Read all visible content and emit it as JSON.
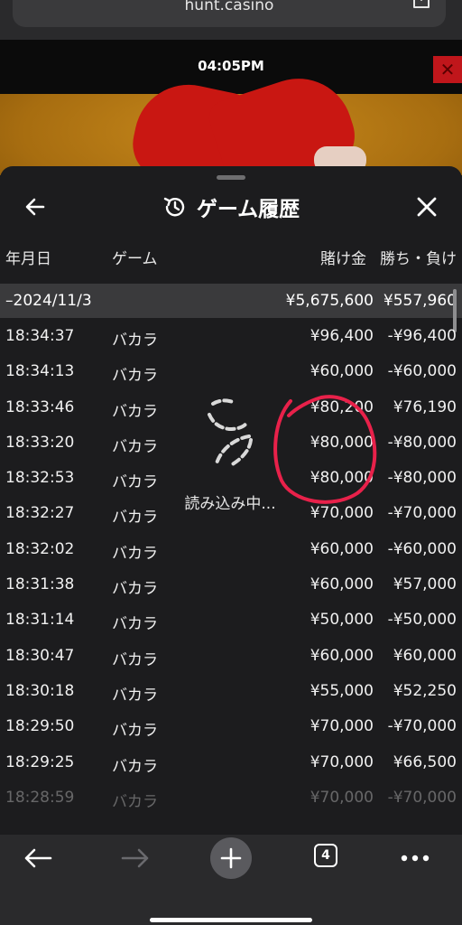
{
  "browser": {
    "url": "hunt.casino",
    "tab_count": "4"
  },
  "stream": {
    "clock": "04:05PM",
    "close_label": "✕"
  },
  "panel": {
    "title": "ゲーム履歴",
    "columns": {
      "date": "年月日",
      "game": "ゲーム",
      "bet": "賭け金",
      "win_loss": "勝ち・負け"
    },
    "summary": {
      "date": "–2024/11/3",
      "bet": "¥5,675,600",
      "win_loss": "¥557,960"
    },
    "rows": [
      {
        "time": "18:34:37",
        "game": "バカラ",
        "bet": "¥96,400",
        "result": "-¥96,400"
      },
      {
        "time": "18:34:13",
        "game": "バカラ",
        "bet": "¥60,000",
        "result": "-¥60,000"
      },
      {
        "time": "18:33:46",
        "game": "バカラ",
        "bet": "¥80,200",
        "result": "¥76,190"
      },
      {
        "time": "18:33:20",
        "game": "バカラ",
        "bet": "¥80,000",
        "result": "-¥80,000"
      },
      {
        "time": "18:32:53",
        "game": "バカラ",
        "bet": "¥80,000",
        "result": "-¥80,000"
      },
      {
        "time": "18:32:27",
        "game": "バカラ",
        "bet": "¥70,000",
        "result": "-¥70,000"
      },
      {
        "time": "18:32:02",
        "game": "バカラ",
        "bet": "¥60,000",
        "result": "-¥60,000"
      },
      {
        "time": "18:31:38",
        "game": "バカラ",
        "bet": "¥60,000",
        "result": "¥57,000"
      },
      {
        "time": "18:31:14",
        "game": "バカラ",
        "bet": "¥50,000",
        "result": "-¥50,000"
      },
      {
        "time": "18:30:47",
        "game": "バカラ",
        "bet": "¥60,000",
        "result": "¥60,000"
      },
      {
        "time": "18:30:18",
        "game": "バカラ",
        "bet": "¥55,000",
        "result": "¥52,250"
      },
      {
        "time": "18:29:50",
        "game": "バカラ",
        "bet": "¥70,000",
        "result": "-¥70,000"
      },
      {
        "time": "18:29:25",
        "game": "バカラ",
        "bet": "¥70,000",
        "result": "¥66,500"
      },
      {
        "time": "18:28:59",
        "game": "バカラ",
        "bet": "¥70,000",
        "result": "-¥70,000"
      }
    ],
    "loading_text": "読み込み中..."
  },
  "colors": {
    "panel_bg": "#1c1c1e",
    "summary_bg": "#3a3a3c",
    "annotation": "#e8214a",
    "toolbar_bg": "#2a2a2c"
  },
  "icons": {
    "back": "back-arrow-icon",
    "history": "history-icon",
    "close": "close-icon",
    "share": "share-icon",
    "spinner": "spinner-icon",
    "toolbar_back": "back-arrow-icon",
    "toolbar_forward": "forward-arrow-icon",
    "new_tab": "plus-icon",
    "more": "more-icon"
  }
}
